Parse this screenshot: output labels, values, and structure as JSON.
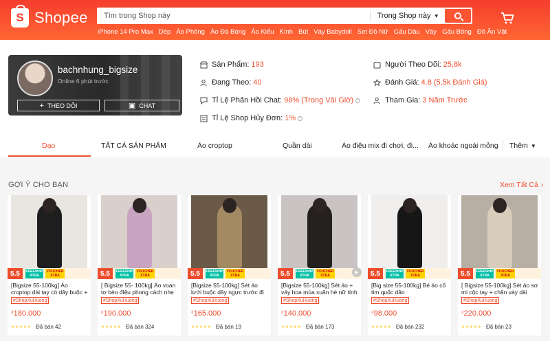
{
  "header": {
    "brand": "Shopee",
    "brand_initial": "S",
    "search_placeholder": "Tìm trong Shop này",
    "search_scope": "Trong Shop này",
    "keywords": [
      "iPhone 14 Pro Max",
      "Dép",
      "Áo Phông",
      "Áo Đá Bóng",
      "Áo Kiểu",
      "Kính",
      "Bút",
      "Váy Babydoll",
      "Set Đồ Nữ",
      "Gấu Dâu",
      "Váy",
      "Gấu Bông",
      "Đồ Ăn Vặt"
    ]
  },
  "shop": {
    "name": "bachnhung_bigsize",
    "online": "Online 6 phút trước",
    "follow_label": "THEO DÕI",
    "chat_label": "CHAT",
    "stats": {
      "products_label": "Sản Phẩm:",
      "products_value": "193",
      "following_label": "Đang Theo:",
      "following_value": "40",
      "response_label": "Tỉ Lệ Phản Hồi Chat:",
      "response_value": "98% (Trong Vài Giờ)",
      "cancel_label": "Tỉ Lệ Shop Hủy Đơn:",
      "cancel_value": "1%",
      "followers_label": "Người Theo Dõi:",
      "followers_value": "25,8k",
      "rating_label": "Đánh Giá:",
      "rating_value": "4.8 (5,5k Đánh Giá)",
      "joined_label": "Tham Gia:",
      "joined_value": "3 Năm Trước"
    }
  },
  "tabs": [
    "Dạo",
    "TẤT CẢ SẢN PHẨM",
    "Áo croptop",
    "Quần dài",
    "Áo điệu mix đi chơi, đi...",
    "Áo khoác ngoài mỏng"
  ],
  "tab_more": "Thêm",
  "suggestions": {
    "title": "GỢI Ý CHO BẠN",
    "see_all": "Xem Tất Cả"
  },
  "product_badges": {
    "sale": "5.5",
    "freeship_top": "FREESHIP",
    "freeship_bottom": "XTRA",
    "voucher_top": "VOUCHER",
    "voucher_bottom": "XTRA"
  },
  "products": [
    {
      "name": "[Bigsize 55-100kg] Áo croptop dài tay có dây buộc + chân váy...",
      "tag": "#ShopXuHuong",
      "currency": "₫",
      "price": "180.000",
      "sold": "Đã bán 42",
      "bg": "#e9e6e2",
      "fig": "#1e1e1e"
    },
    {
      "name": "[ Bigsize 55- 100kg] Áo voan tơ bèo điệu phong cách nhẹ nhà...",
      "tag": "#ShopXuHuong",
      "currency": "₫",
      "price": "190.000",
      "sold": "Đã bán 324",
      "bg": "#d9d0cc",
      "fig": "#c9a4c0"
    },
    {
      "name": "[Bigsize 55-100kg] Sét áo lưới buộc dây ngực trước đi chơi, ...",
      "tag": "#ShopXuHuong",
      "currency": "₫",
      "price": "165.000",
      "sold": "Đã bán 19",
      "bg": "#6b5a48",
      "fig": "#a38a62"
    },
    {
      "name": "[Bigsize 55-100kg] Sét áo + váy hoa mùa xuân hè nữ tính",
      "tag": "#ShopXuHuong",
      "currency": "₫",
      "price": "140.000",
      "sold": "Đã bán 173",
      "bg": "#c9c4c3",
      "fig": "#242020"
    },
    {
      "name": "[Big size 55-100kg] Bé áo cổ tim quốc dân",
      "tag": "#ShopXuHuong",
      "currency": "₫",
      "price": "98.000",
      "sold": "Đã bán 232",
      "bg": "#efeeec",
      "fig": "#161616"
    },
    {
      "name": "[ Bigsize 55-100kg] Sét áo sơ mi cộc tay + chân váy dài",
      "tag": "#ShopXuHuong",
      "currency": "₫",
      "price": "220.000",
      "sold": "Đã bán 23",
      "bg": "#b7aea4",
      "fig": "#d8cdbb"
    }
  ],
  "colors": {
    "brand": "#ee4d2d",
    "header": "#f53d2d",
    "star": "#ffce3d"
  },
  "icons": [
    "cart-icon",
    "search-icon",
    "store-icon",
    "user-plus-icon",
    "chat-icon",
    "star-icon",
    "user-check-icon",
    "shop-cancel-icon",
    "users-icon",
    "play-icon"
  ]
}
